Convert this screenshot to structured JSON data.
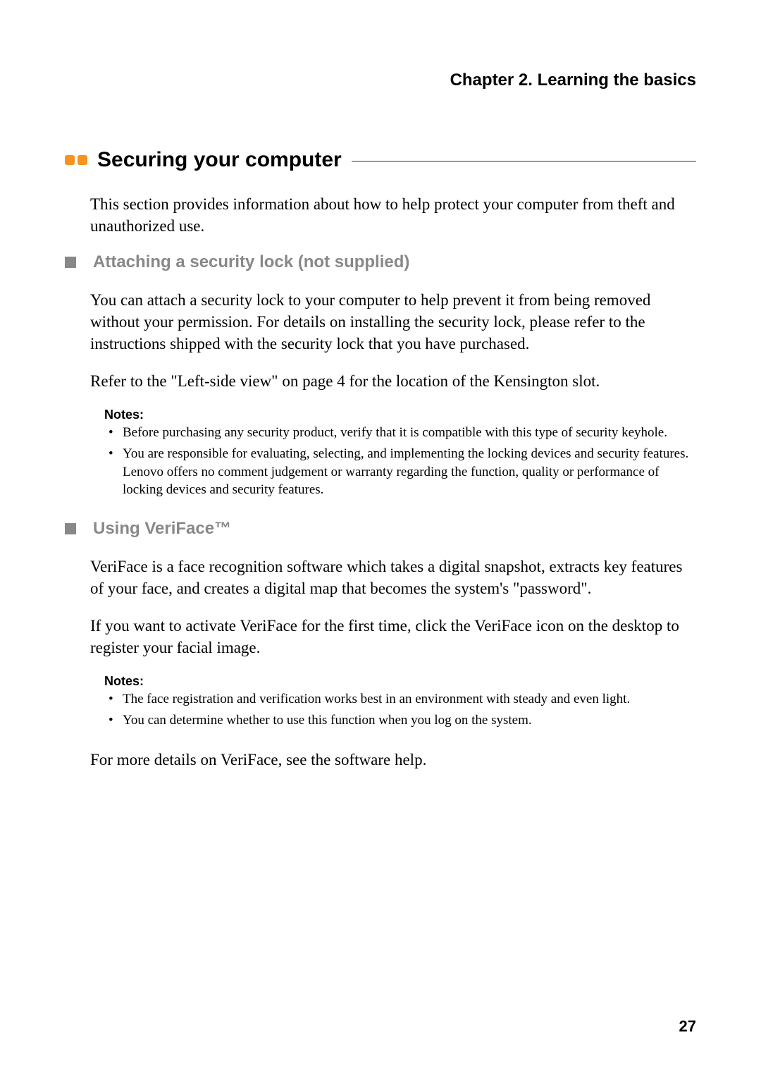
{
  "chapter_header": "Chapter 2. Learning the basics",
  "section_title": "Securing your computer",
  "intro_text": "This section provides information about how to help protect your computer from theft and unauthorized use.",
  "sub1": {
    "title": "Attaching a security lock (not supplied)",
    "para1": "You can attach a security lock to your computer to help prevent it from being removed without your permission. For details on installing the security lock, please refer to the instructions shipped with the security lock that you have purchased.",
    "para2": "Refer to the \"Left-side view\" on page 4 for the location of the Kensington slot.",
    "notes_label": "Notes:",
    "notes": [
      "Before purchasing any security product, verify that it is compatible with this type of security keyhole.",
      "You are responsible for evaluating, selecting, and implementing the locking devices and security features. Lenovo offers no comment judgement or warranty regarding the function, quality or performance of locking devices and security features."
    ]
  },
  "sub2": {
    "title": "Using VeriFace™",
    "para1": "VeriFace is a face recognition software which takes a digital snapshot, extracts key features of your face, and creates a digital map that becomes the system's \"password\".",
    "para2": "If you want to activate VeriFace for the first time, click the VeriFace icon on the desktop to register your facial image.",
    "notes_label": "Notes:",
    "notes": [
      "The face registration and verification works best in an environment with steady and even light.",
      "You can determine whether to use this function when you log on the system."
    ],
    "para3": "For more details on VeriFace, see the software help."
  },
  "page_number": "27"
}
